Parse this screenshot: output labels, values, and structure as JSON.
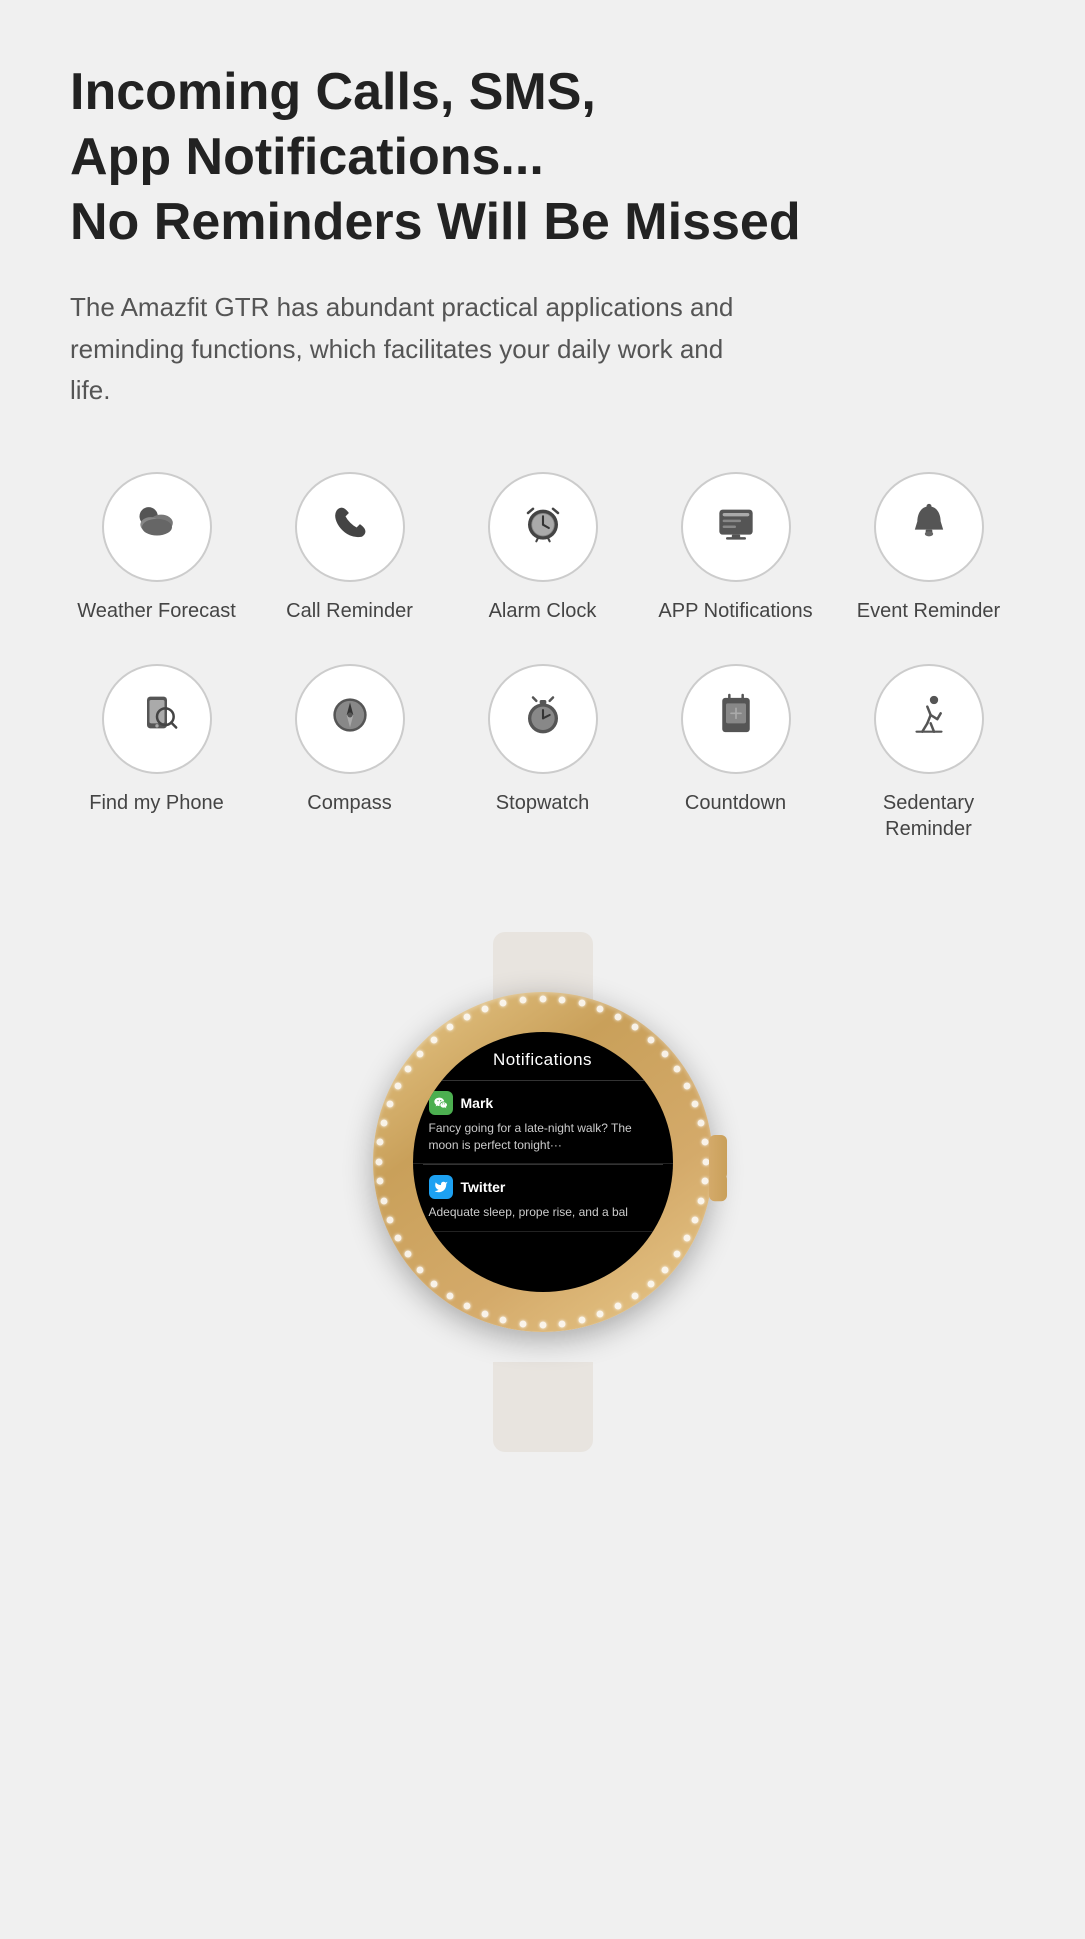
{
  "headline": {
    "line1": "Incoming Calls, SMS,",
    "line2": "App Notifications...",
    "line3": "No Reminders Will Be Missed"
  },
  "description": "The Amazfit GTR has abundant practical applications and reminding functions, which facilitates your daily work and life.",
  "features": [
    {
      "id": "weather-forecast",
      "label": "Weather Forecast",
      "icon": "weather"
    },
    {
      "id": "call-reminder",
      "label": "Call Reminder",
      "icon": "call"
    },
    {
      "id": "alarm-clock",
      "label": "Alarm Clock",
      "icon": "alarm"
    },
    {
      "id": "app-notifications",
      "label": "APP Notifications",
      "icon": "notification"
    },
    {
      "id": "event-reminder",
      "label": "Event Reminder",
      "icon": "bell"
    },
    {
      "id": "find-my-phone",
      "label": "Find my Phone",
      "icon": "findphone"
    },
    {
      "id": "compass",
      "label": "Compass",
      "icon": "compass"
    },
    {
      "id": "stopwatch",
      "label": "Stopwatch",
      "icon": "stopwatch"
    },
    {
      "id": "countdown",
      "label": "Countdown",
      "icon": "countdown"
    },
    {
      "id": "sedentary-reminder",
      "label": "Sedentary Reminder",
      "icon": "sedentary"
    }
  ],
  "watch": {
    "screen_title": "Notifications",
    "notifications": [
      {
        "app": "Mark",
        "app_icon": "wechat",
        "message": "Fancy going for a late-night walk? The moon is perfect tonight···"
      },
      {
        "app": "Twitter",
        "app_icon": "twitter",
        "message": "Adequate sleep, prope rise, and a bal"
      }
    ]
  }
}
